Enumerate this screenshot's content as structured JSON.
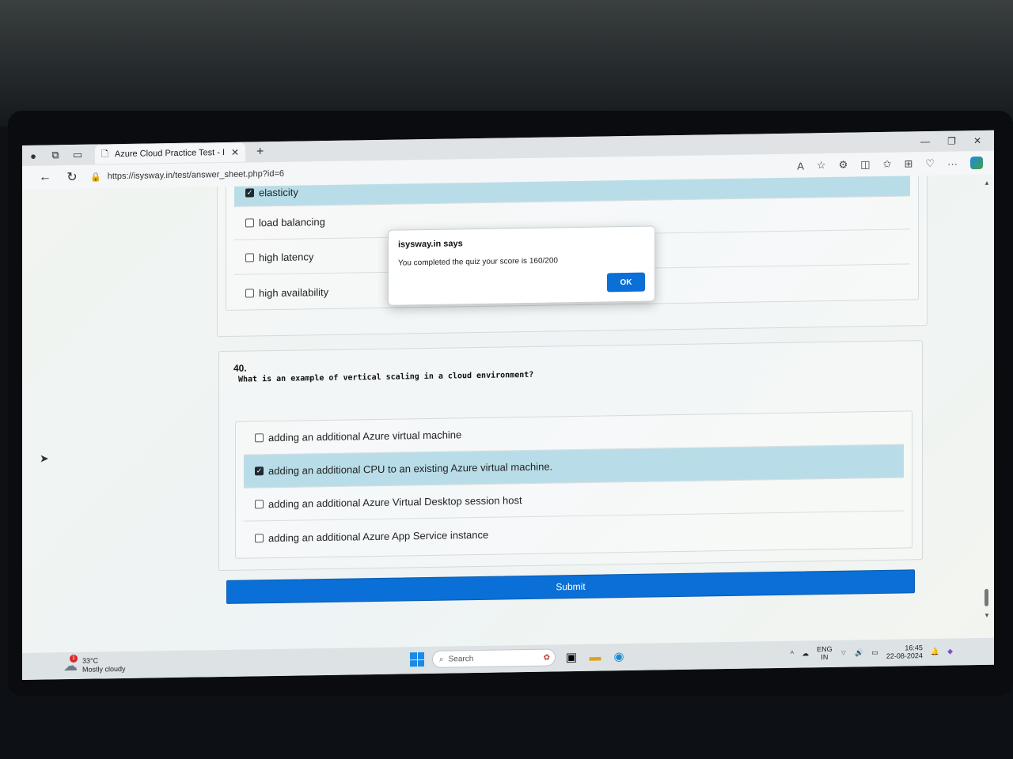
{
  "browser": {
    "tab_title": "Azure Cloud Practice Test - I | Ar",
    "url": "https://isysway.in/test/answer_sheet.php?id=6",
    "icons": [
      "back-icon",
      "refresh-icon",
      "lock-icon",
      "read-aloud-icon",
      "favorite-icon",
      "extensions-icon",
      "split-screen-icon",
      "favorites-icon",
      "collections-icon",
      "performance-icon",
      "more-icon",
      "copilot-icon"
    ]
  },
  "question_39": {
    "options": [
      {
        "label": "elasticity",
        "checked": true
      },
      {
        "label": "load balancing",
        "checked": false
      },
      {
        "label": "high latency",
        "checked": false
      },
      {
        "label": "high availability",
        "checked": false
      }
    ]
  },
  "question_40": {
    "number": "40.",
    "text": "What is an example of vertical scaling in a cloud environment?",
    "options": [
      {
        "label": "adding an additional Azure virtual machine",
        "checked": false
      },
      {
        "label": "adding an additional CPU to an existing Azure virtual machine.",
        "checked": true
      },
      {
        "label": "adding an additional Azure Virtual Desktop session host",
        "checked": false
      },
      {
        "label": "adding an additional Azure App Service instance",
        "checked": false
      }
    ]
  },
  "submit_label": "Submit",
  "dialog": {
    "site": "isysway.in says",
    "message": "You completed the quiz your score is 160/200",
    "ok_label": "OK"
  },
  "taskbar": {
    "weather_badge": "1",
    "temperature": "33°C",
    "condition": "Mostly cloudy",
    "search_placeholder": "Search",
    "lang_top": "ENG",
    "lang_bottom": "IN",
    "time": "16:45",
    "date": "22-08-2024"
  }
}
